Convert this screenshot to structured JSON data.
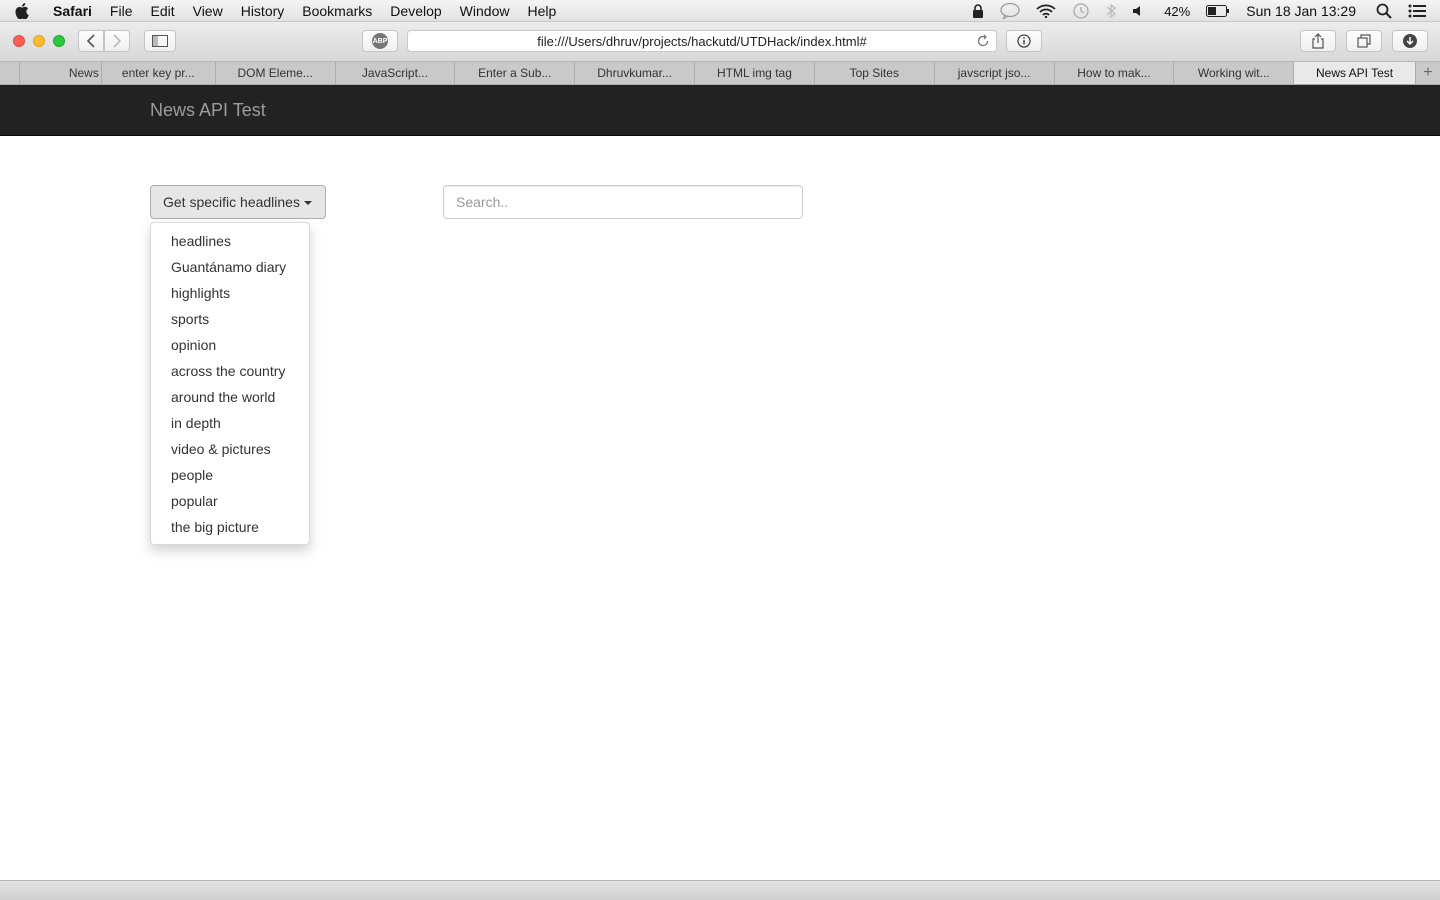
{
  "menubar": {
    "app_name": "Safari",
    "items": [
      "File",
      "Edit",
      "View",
      "History",
      "Bookmarks",
      "Develop",
      "Window",
      "Help"
    ],
    "battery": "42%",
    "clock": "Sun 18 Jan  13:29"
  },
  "browser": {
    "url": "file:///Users/dhruv/projects/hackutd/UTDHack/index.html#",
    "adblock_label": "ABP",
    "tabs": [
      {
        "label": ""
      },
      {
        "label": "News"
      },
      {
        "label": "enter key pr..."
      },
      {
        "label": "DOM Eleme..."
      },
      {
        "label": "JavaScript..."
      },
      {
        "label": "Enter a Sub..."
      },
      {
        "label": "Dhruvkumar..."
      },
      {
        "label": "HTML img tag"
      },
      {
        "label": "Top Sites"
      },
      {
        "label": "javscript jso..."
      },
      {
        "label": "How to mak..."
      },
      {
        "label": "Working wit..."
      },
      {
        "label": "News API Test"
      }
    ],
    "new_tab_label": "+"
  },
  "page": {
    "brand": "News API Test",
    "dropdown": {
      "button_label": "Get specific headlines",
      "items": [
        "headlines",
        "Guantánamo diary",
        "highlights",
        "sports",
        "opinion",
        "across the country",
        "around the world",
        "in depth",
        "video & pictures",
        "people",
        "popular",
        "the big picture"
      ]
    },
    "search": {
      "placeholder": "Search..",
      "value": ""
    }
  }
}
